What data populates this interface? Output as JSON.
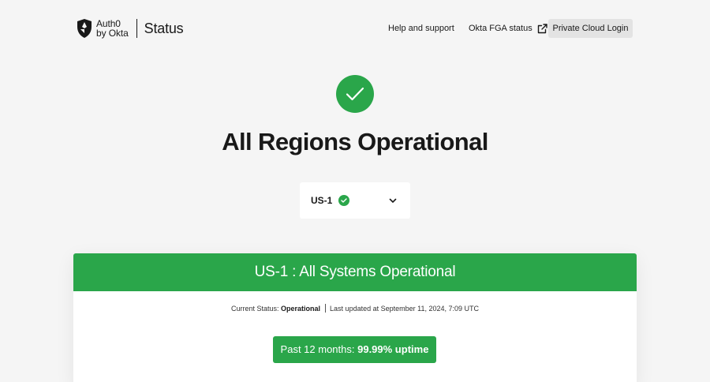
{
  "header": {
    "brand_line1": "Auth0",
    "brand_line2": "by Okta",
    "brand_status": "Status",
    "nav": {
      "help_label": "Help and support",
      "fga_label": "Okta FGA status",
      "login_label": "Private Cloud Login"
    }
  },
  "hero": {
    "title": "All Regions Operational",
    "icon": "check-circle-icon"
  },
  "region_select": {
    "selected": "US-1",
    "status_icon": "check-circle-icon",
    "chevron_icon": "chevron-down-icon"
  },
  "panel": {
    "title": "US-1 : All Systems Operational",
    "status_prefix": "Current Status:",
    "status_value": "Operational",
    "last_updated": "Last updated at September 11, 2024, 7:09 UTC",
    "uptime_prefix": "Past 12 months:",
    "uptime_value": "99.99% uptime"
  },
  "colors": {
    "success": "#2aa64a",
    "background": "#f5f5f5",
    "text": "#191919",
    "button_gray": "#e3e3e3"
  }
}
